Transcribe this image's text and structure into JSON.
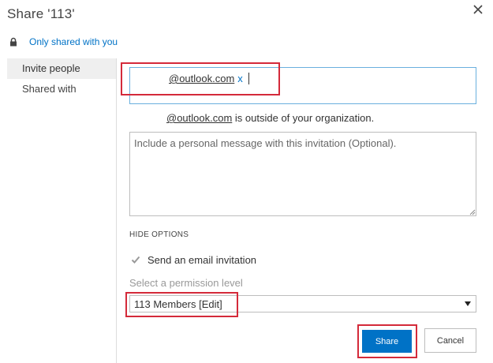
{
  "dialog": {
    "title": "Share '113'",
    "close_icon": "close-icon"
  },
  "share_status": {
    "icon": "lock-icon",
    "text": "Only shared with you"
  },
  "sidebar": {
    "items": [
      {
        "label": "Invite people",
        "active": true
      },
      {
        "label": "Shared with",
        "active": false
      }
    ]
  },
  "invite": {
    "recipient_token": "@outlook.com",
    "remove_label": "x",
    "warning_address": "@outlook.com",
    "warning_text": " is outside of your organization.",
    "message_placeholder": "Include a personal message with this invitation (Optional).",
    "message_value": ""
  },
  "options": {
    "hide_options_label": "HIDE OPTIONS",
    "send_email_label": "Send an email invitation",
    "send_email_checked": true,
    "permission_label": "Select a permission level",
    "permission_selected": "113 Members [Edit]"
  },
  "buttons": {
    "share": "Share",
    "cancel": "Cancel"
  },
  "colors": {
    "accent": "#0072c6",
    "highlight": "#d42a3a",
    "border": "#bdbdbd"
  }
}
